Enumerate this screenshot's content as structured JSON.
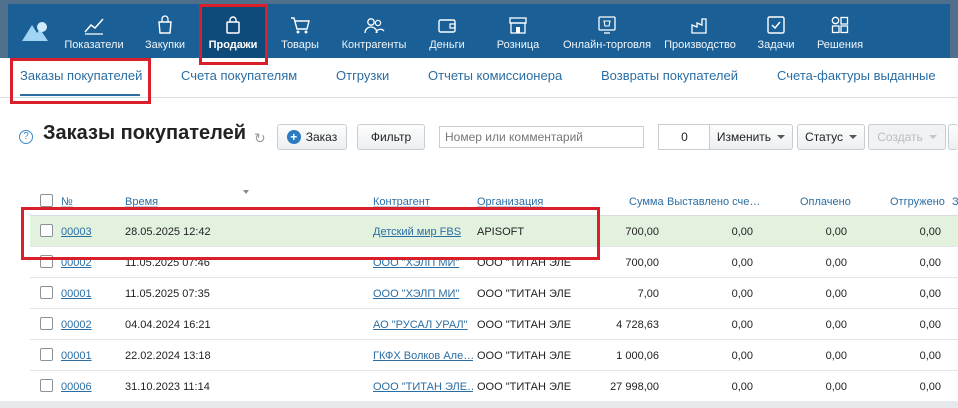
{
  "topnav": {
    "items": [
      {
        "label": "Показатели",
        "icon": "chart-line-icon"
      },
      {
        "label": "Закупки",
        "icon": "purchase-bag-icon"
      },
      {
        "label": "Продажи",
        "icon": "sales-bag-icon"
      },
      {
        "label": "Товары",
        "icon": "cart-icon"
      },
      {
        "label": "Контрагенты",
        "icon": "people-icon"
      },
      {
        "label": "Деньги",
        "icon": "wallet-icon"
      },
      {
        "label": "Розница",
        "icon": "store-icon"
      },
      {
        "label": "Онлайн-торговля",
        "icon": "online-shop-icon"
      },
      {
        "label": "Производство",
        "icon": "factory-icon"
      },
      {
        "label": "Задачи",
        "icon": "checkbox-task-icon"
      },
      {
        "label": "Решения",
        "icon": "apps-grid-icon"
      }
    ],
    "active_index": 2
  },
  "subtabs": [
    "Заказы покупателей",
    "Счета покупателям",
    "Отгрузки",
    "Отчеты комиссионера",
    "Возвраты покупателей",
    "Счета-фактуры выданные"
  ],
  "toolbar": {
    "help": "?",
    "title": "Заказы покупателей",
    "add_label": "Заказ",
    "filter_label": "Фильтр",
    "search_placeholder": "Номер или комментарий",
    "count": "0",
    "change_label": "Изменить",
    "status_label": "Статус",
    "create_label": "Создать"
  },
  "table": {
    "columns": [
      "№",
      "Время",
      "Контрагент",
      "Организация",
      "Сумма",
      "Выставлено сче…",
      "Оплачено",
      "Отгружено",
      "З"
    ],
    "rows": [
      {
        "num": "00003",
        "time": "28.05.2025 12:42",
        "agent": "Детский мир FBS",
        "org": "APISOFT",
        "sum": "700,00",
        "invoiced": "0,00",
        "paid": "0,00",
        "shipped": "0,00"
      },
      {
        "num": "00002",
        "time": "11.05.2025 07:46",
        "agent": "ООО \"ХЭЛП МИ\"",
        "org": "ООО \"ТИТАН ЭЛЕ",
        "sum": "700,00",
        "invoiced": "0,00",
        "paid": "0,00",
        "shipped": "0,00"
      },
      {
        "num": "00001",
        "time": "11.05.2025 07:35",
        "agent": "ООО \"ХЭЛП МИ\"",
        "org": "ООО \"ТИТАН ЭЛЕ",
        "sum": "7,00",
        "invoiced": "0,00",
        "paid": "0,00",
        "shipped": "0,00"
      },
      {
        "num": "00002",
        "time": "04.04.2024 16:21",
        "agent": "АО \"РУСАЛ УРАЛ\"",
        "org": "ООО \"ТИТАН ЭЛЕ",
        "sum": "4 728,63",
        "invoiced": "0,00",
        "paid": "0,00",
        "shipped": "0,00"
      },
      {
        "num": "00001",
        "time": "22.02.2024 13:18",
        "agent": "ГКФХ Волков Але…",
        "org": "ООО \"ТИТАН ЭЛЕ",
        "sum": "1 000,06",
        "invoiced": "0,00",
        "paid": "0,00",
        "shipped": "0,00"
      },
      {
        "num": "00006",
        "time": "31.10.2023 11:14",
        "agent": "ООО \"ТИТАН ЭЛЕ…",
        "org": "ООО \"ТИТАН ЭЛЕ",
        "sum": "27 998,00",
        "invoiced": "0,00",
        "paid": "0,00",
        "shipped": "0,00"
      }
    ],
    "selected_row": 0
  },
  "colors": {
    "nav_bg": "#1a5f95",
    "accent": "#2b6ea3",
    "highlight_row": "#e2f2df",
    "annotation": "#d9202a"
  }
}
